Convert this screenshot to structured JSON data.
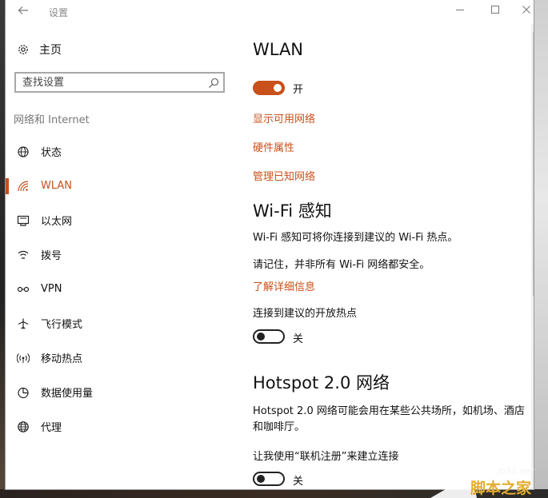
{
  "window": {
    "title": "设置",
    "back_icon": "arrow-left-icon",
    "controls": {
      "minimize": "minimize-icon",
      "maximize": "maximize-icon",
      "close": "close-icon"
    }
  },
  "sidebar": {
    "home_label": "主页",
    "search_placeholder": "查找设置",
    "section_label": "网络和 Internet",
    "items": [
      {
        "label": "状态",
        "icon": "globe-status-icon",
        "active": false
      },
      {
        "label": "WLAN",
        "icon": "wifi-icon",
        "active": true
      },
      {
        "label": "以太网",
        "icon": "ethernet-icon",
        "active": false
      },
      {
        "label": "拨号",
        "icon": "dialup-icon",
        "active": false
      },
      {
        "label": "VPN",
        "icon": "vpn-icon",
        "active": false
      },
      {
        "label": "飞行模式",
        "icon": "airplane-icon",
        "active": false
      },
      {
        "label": "移动热点",
        "icon": "hotspot-icon",
        "active": false
      },
      {
        "label": "数据使用量",
        "icon": "data-usage-icon",
        "active": false
      },
      {
        "label": "代理",
        "icon": "proxy-globe-icon",
        "active": false
      }
    ]
  },
  "main": {
    "title": "WLAN",
    "wlan_toggle": {
      "state": "on",
      "label": "开"
    },
    "links": [
      "显示可用网络",
      "硬件属性",
      "管理已知网络"
    ],
    "wifi_sense": {
      "title": "Wi-Fi 感知",
      "desc": "Wi-Fi 感知可将你连接到建议的 Wi-Fi 热点。",
      "note": "请记住，并非所有 Wi-Fi 网络都安全。",
      "learn_more": "了解详细信息",
      "toggle_title": "连接到建议的开放热点",
      "toggle": {
        "state": "off",
        "label": "关"
      }
    },
    "hotspot2": {
      "title": "Hotspot 2.0 网络",
      "desc": "Hotspot 2.0 网络可能会用在某些公共场所，如机场、酒店和咖啡厅。",
      "toggle_title": "让我使用“联机注册”来建立连接",
      "toggle": {
        "state": "off",
        "label": "关"
      }
    }
  },
  "watermark": {
    "url": "jb51.net",
    "text": "脚本之家"
  },
  "colors": {
    "accent": "#c8501a",
    "text": "#111111",
    "muted": "#777777"
  }
}
